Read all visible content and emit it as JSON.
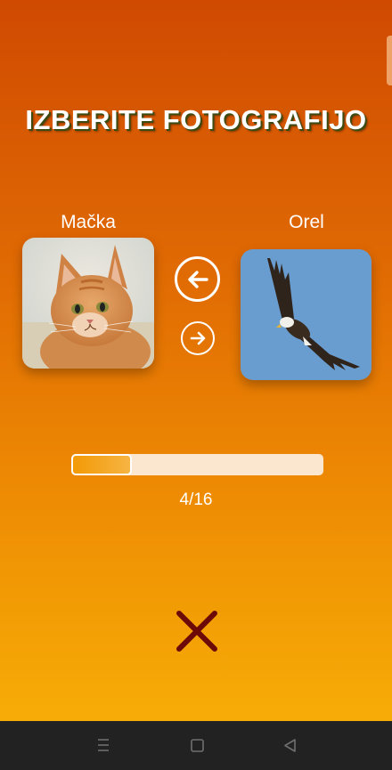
{
  "title": "IZBERITE FOTOGRAFIJO",
  "left_option": {
    "label": "Mačka",
    "image": "cat-photo"
  },
  "right_option": {
    "label": "Orel",
    "image": "eagle-photo"
  },
  "controls": {
    "choose_left_icon": "arrow-left-circle-icon",
    "choose_right_icon": "arrow-right-circle-icon",
    "close_icon": "close-x-icon"
  },
  "progress": {
    "current": 4,
    "total": 16,
    "text": "4/16",
    "fraction": 0.24
  },
  "navbar": {
    "menu_icon": "menu-icon",
    "home_icon": "home-square-icon",
    "back_icon": "back-triangle-icon"
  },
  "colors": {
    "background_top": "#d04a02",
    "background_bottom": "#f6ab06",
    "close_x": "#6b0a07",
    "progress_track": "#fbe6cf",
    "progress_fill": "#f39a06",
    "navbar": "#222222"
  }
}
